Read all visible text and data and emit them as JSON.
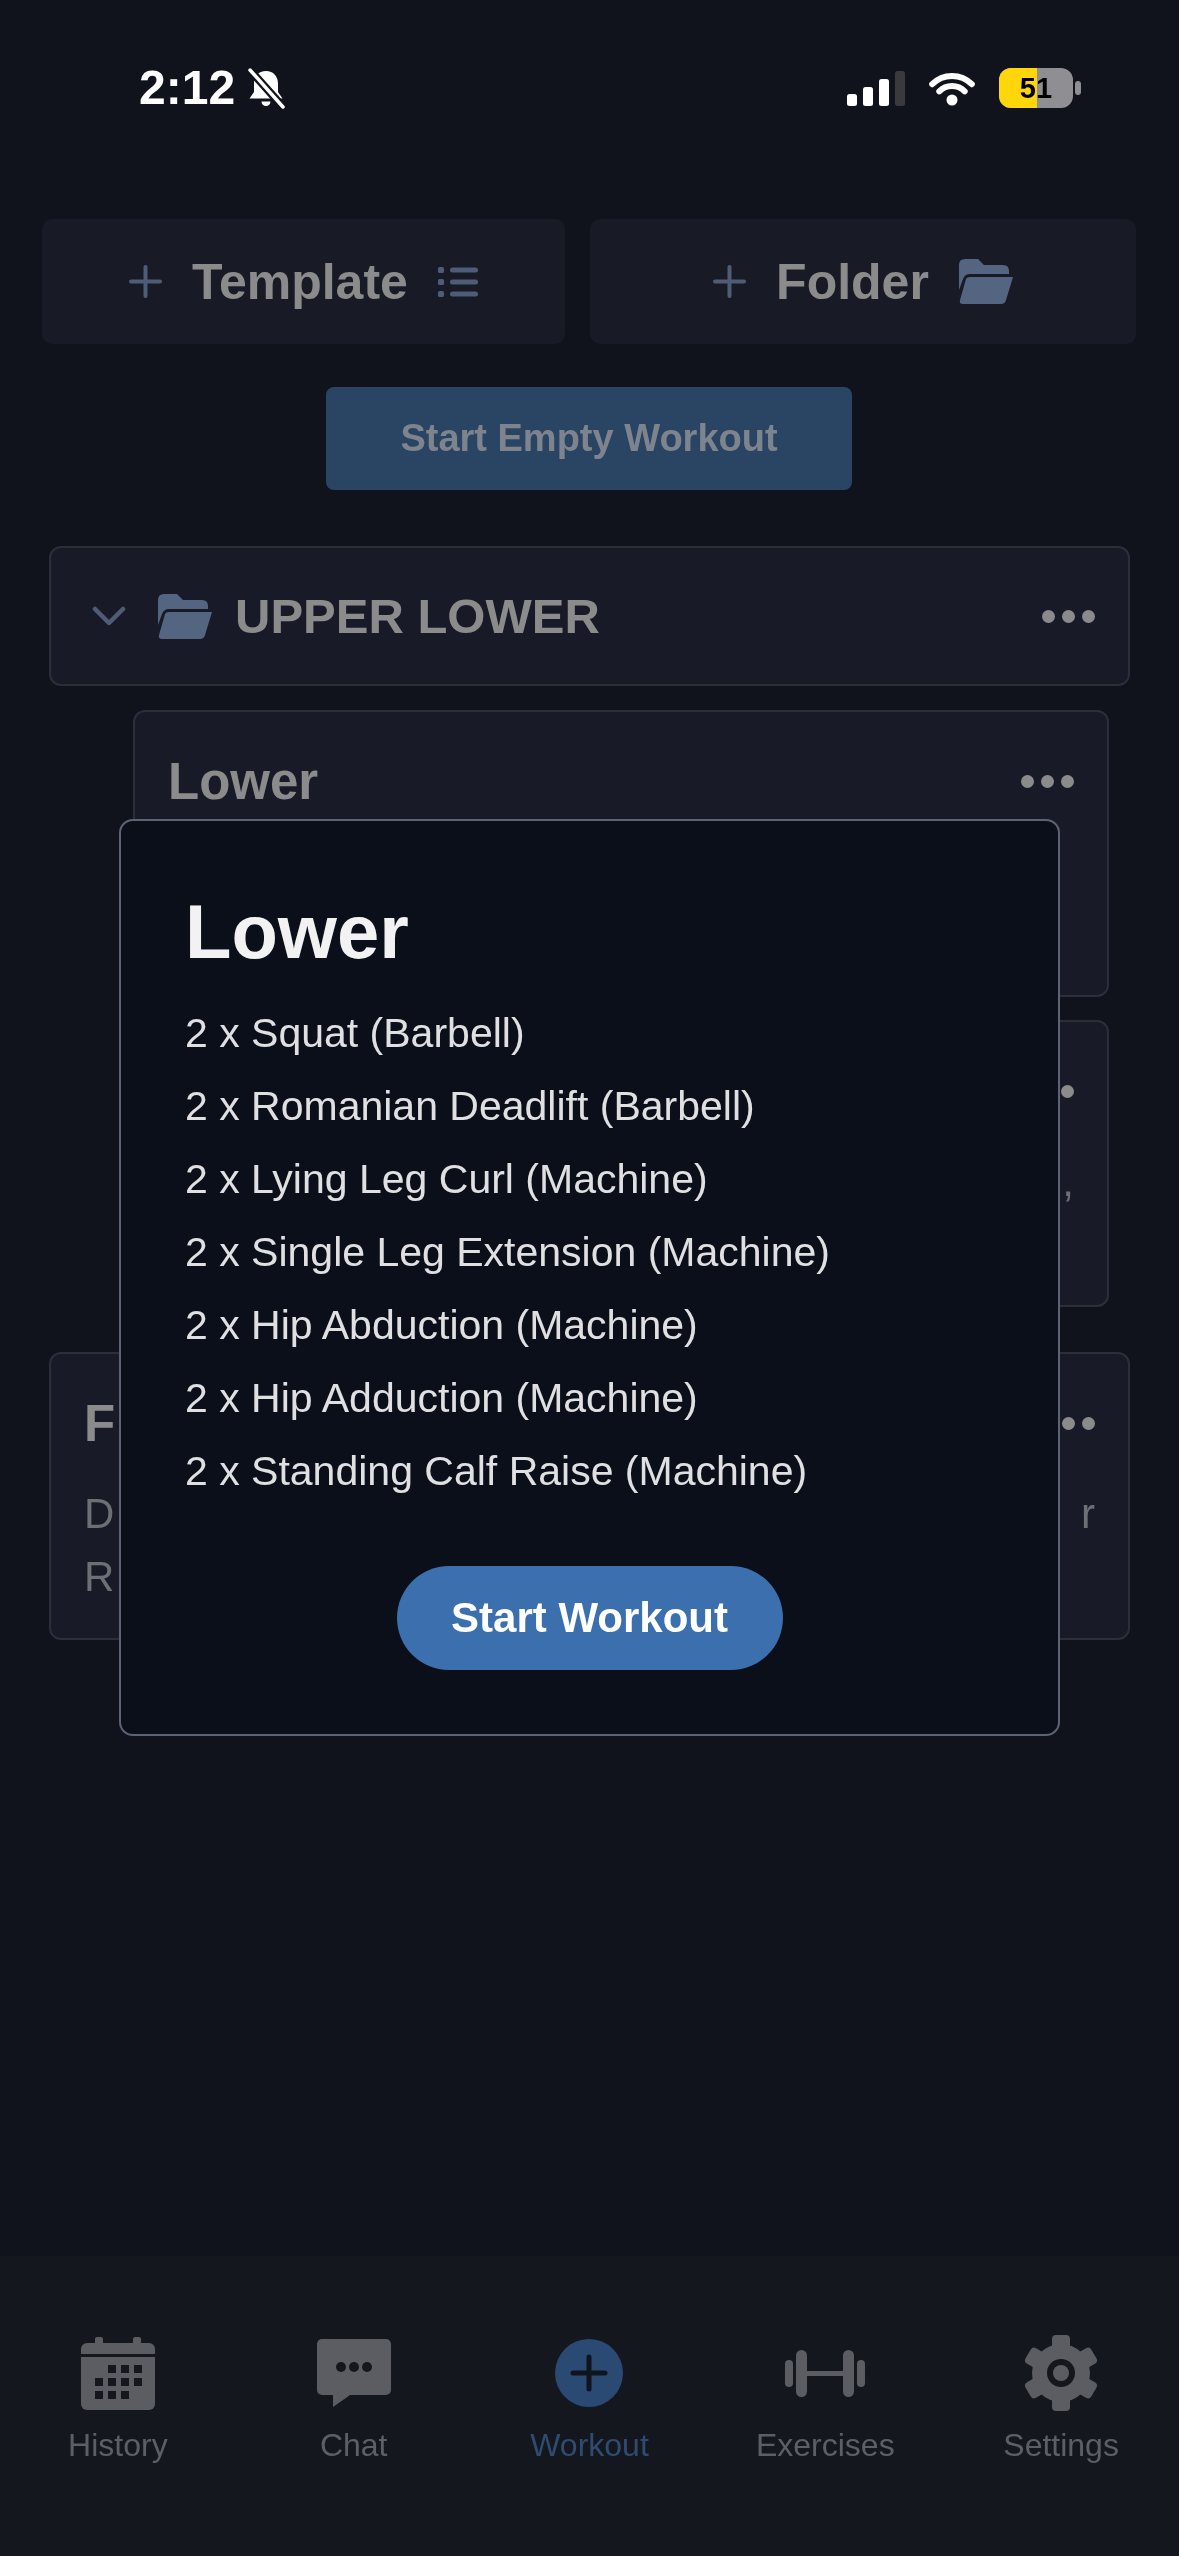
{
  "status_bar": {
    "time": "2:12",
    "silent": true,
    "battery": "51"
  },
  "actions": [
    {
      "kind": "template",
      "label": "Template"
    },
    {
      "kind": "folder",
      "label": "Folder"
    }
  ],
  "start_empty": {
    "label": "Start Empty Workout"
  },
  "folders": [
    {
      "name": "UPPER LOWER",
      "expanded": true,
      "templates": [
        {
          "kind": "full",
          "title": "Lower"
        },
        {
          "kind": "edge",
          "lines": [
            {
              "right": ","
            }
          ]
        }
      ]
    }
  ],
  "templates": [
    {
      "kind": "full",
      "title": "F",
      "lines": [
        {
          "left": "D",
          "right": "r"
        },
        {
          "left": "R"
        }
      ]
    }
  ],
  "modal": {
    "title": "Lower",
    "exercises": [
      "2 x Squat (Barbell)",
      "2 x Romanian Deadlift (Barbell)",
      "2 x Lying Leg Curl (Machine)",
      "2 x Single Leg Extension (Machine)",
      "2 x Hip Abduction (Machine)",
      "2 x Hip Adduction (Machine)",
      "2 x Standing Calf Raise (Machine)"
    ],
    "button": "Start Workout"
  },
  "tab_bar": [
    {
      "kind": "history",
      "label": "History",
      "selected": false
    },
    {
      "kind": "chat",
      "label": "Chat",
      "selected": false
    },
    {
      "kind": "workout",
      "label": "Workout",
      "selected": true
    },
    {
      "kind": "exercises",
      "label": "Exercises",
      "selected": false
    },
    {
      "kind": "settings",
      "label": "Settings",
      "selected": false
    }
  ]
}
